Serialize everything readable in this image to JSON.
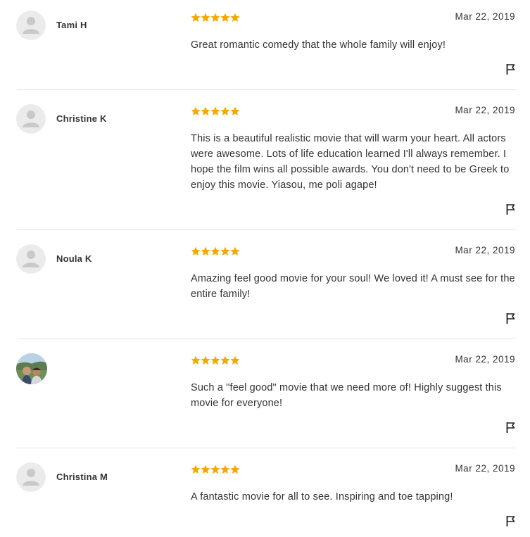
{
  "colors": {
    "star": "#f5a800",
    "avatar_placeholder_bg": "#e8e8e8",
    "avatar_placeholder_fg": "#c7c7c7",
    "divider": "#e4e4e4"
  },
  "reviews": [
    {
      "name": "Tami H",
      "rating": 5,
      "date": "Mar 22, 2019",
      "text": "Great romantic comedy that the whole family will enjoy!",
      "avatar": "placeholder-avatar-icon"
    },
    {
      "name": "Christine K",
      "rating": 5,
      "date": "Mar 22, 2019",
      "text": "This is a beautiful realistic movie that will warm your heart. All actors were awesome. Lots of life education learned I'll always remember. I hope the film wins all possible awards. You don't need to be Greek to enjoy this movie. Yiasou, me poli agape!",
      "avatar": "placeholder-avatar-icon"
    },
    {
      "name": "Noula K",
      "rating": 5,
      "date": "Mar 22, 2019",
      "text": "Amazing feel good movie for your soul! We loved it! A must see for the entire family!",
      "avatar": "placeholder-avatar-icon"
    },
    {
      "name": "",
      "rating": 5,
      "date": "Mar 22, 2019",
      "text": "Such a \"feel good\" movie that we need more of! Highly suggest this movie for everyone!",
      "avatar": "user-photo"
    },
    {
      "name": "Christina M",
      "rating": 5,
      "date": "Mar 22, 2019",
      "text": "A fantastic movie for all to see. Inspiring and toe tapping!",
      "avatar": "placeholder-avatar-icon"
    }
  ]
}
